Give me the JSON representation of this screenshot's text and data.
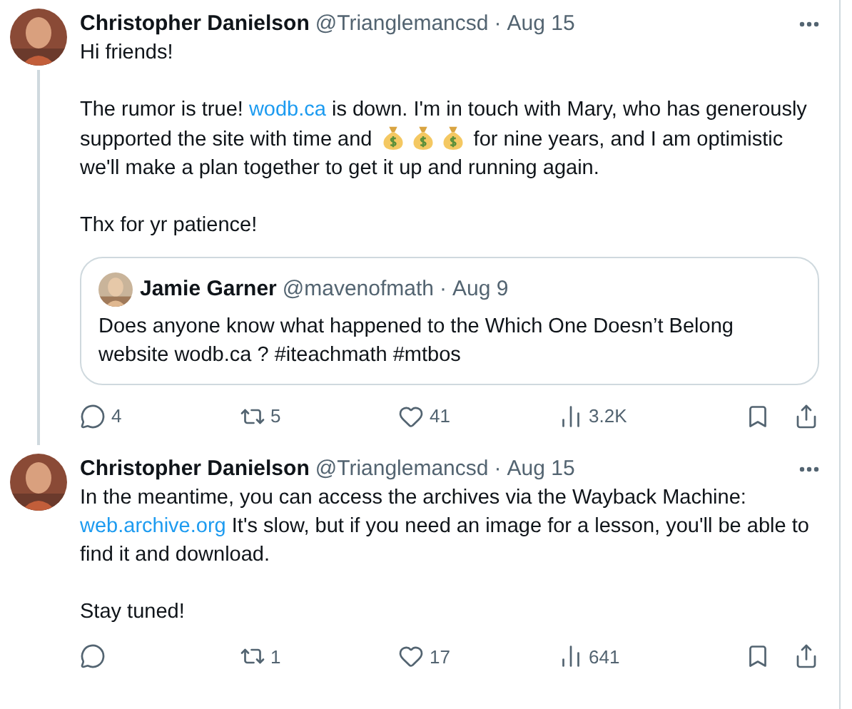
{
  "tweets": [
    {
      "author": "Christopher Danielson",
      "handle": "@Trianglemancsd",
      "dot": "·",
      "date": "Aug 15",
      "threaded": true,
      "paragraphs": [
        [
          {
            "kind": "text",
            "text": "Hi friends!"
          }
        ],
        [
          {
            "kind": "text",
            "text": "The rumor is true! "
          },
          {
            "kind": "link",
            "text": "wodb.ca"
          },
          {
            "kind": "text",
            "text": " is down. I'm in touch with Mary, who has generously supported the site with time and "
          },
          {
            "kind": "emoji"
          },
          {
            "kind": "emoji"
          },
          {
            "kind": "emoji"
          },
          {
            "kind": "text",
            "text": " for nine years, and I am optimistic we'll make a plan together to get it up and running again."
          }
        ],
        [
          {
            "kind": "text",
            "text": "Thx for yr patience!"
          }
        ]
      ],
      "quote": {
        "author": "Jamie Garner",
        "handle": "@mavenofmath",
        "dot": "·",
        "date": "Aug 9",
        "text": "Does anyone know what happened to the Which One Doesn’t Belong website wodb.ca ? #iteachmath #mtbos"
      },
      "actions": [
        {
          "kind": "reply",
          "count": "4"
        },
        {
          "kind": "retweet",
          "count": "5"
        },
        {
          "kind": "like",
          "count": "41"
        },
        {
          "kind": "views",
          "count": "3.2K"
        },
        {
          "kind": "bookmark"
        },
        {
          "kind": "share"
        }
      ]
    },
    {
      "author": "Christopher Danielson",
      "handle": "@Trianglemancsd",
      "dot": "·",
      "date": "Aug 15",
      "threaded": false,
      "paragraphs": [
        [
          {
            "kind": "text",
            "text": "In the meantime, you can access the archives via the Wayback Machine: "
          },
          {
            "kind": "link",
            "text": "web.archive.org"
          },
          {
            "kind": "text",
            "text": " It's slow, but if you need an image for a lesson, you'll be able to find it and download."
          }
        ],
        [
          {
            "kind": "text",
            "text": "Stay tuned!"
          }
        ]
      ],
      "actions": [
        {
          "kind": "reply"
        },
        {
          "kind": "retweet",
          "count": "1"
        },
        {
          "kind": "like",
          "count": "17"
        },
        {
          "kind": "views",
          "count": "641"
        },
        {
          "kind": "bookmark"
        },
        {
          "kind": "share"
        }
      ]
    }
  ]
}
